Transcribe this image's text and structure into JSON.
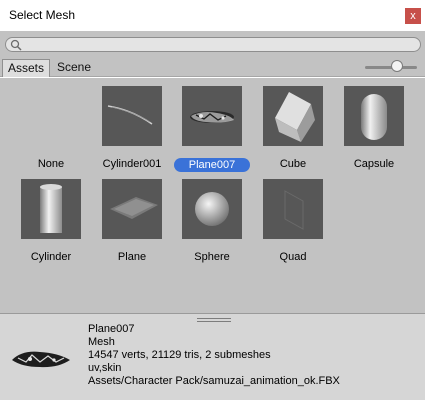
{
  "window": {
    "title": "Select Mesh",
    "close_glyph": "x"
  },
  "search": {
    "placeholder": "",
    "value": ""
  },
  "tabs": [
    {
      "label": "Assets",
      "active": true
    },
    {
      "label": "Scene",
      "active": false
    }
  ],
  "zoom_slider": {
    "value": 0.6
  },
  "items": [
    {
      "label": "None",
      "icon": "none",
      "selected": false
    },
    {
      "label": "Cylinder001",
      "icon": "cylinder001-thumbnail-icon",
      "selected": false
    },
    {
      "label": "Plane007",
      "icon": "plane007-thumbnail-icon",
      "selected": true
    },
    {
      "label": "Cube",
      "icon": "cube-thumbnail-icon",
      "selected": false
    },
    {
      "label": "Capsule",
      "icon": "capsule-thumbnail-icon",
      "selected": false
    },
    {
      "label": "Cylinder",
      "icon": "cylinder-thumbnail-icon",
      "selected": false
    },
    {
      "label": "Plane",
      "icon": "plane-thumbnail-icon",
      "selected": false
    },
    {
      "label": "Sphere",
      "icon": "sphere-thumbnail-icon",
      "selected": false
    },
    {
      "label": "Quad",
      "icon": "quad-thumbnail-icon",
      "selected": false
    }
  ],
  "preview": {
    "name": "Plane007",
    "type": "Mesh",
    "stats": "14547 verts, 21129 tris, 2 submeshes",
    "channels": "uv,skin",
    "path": "Assets/Character Pack/samuzai_animation_ok.FBX"
  },
  "colors": {
    "selection": "#3a72d8",
    "close": "#c7504a",
    "thumbnail_bg": "#575757"
  }
}
